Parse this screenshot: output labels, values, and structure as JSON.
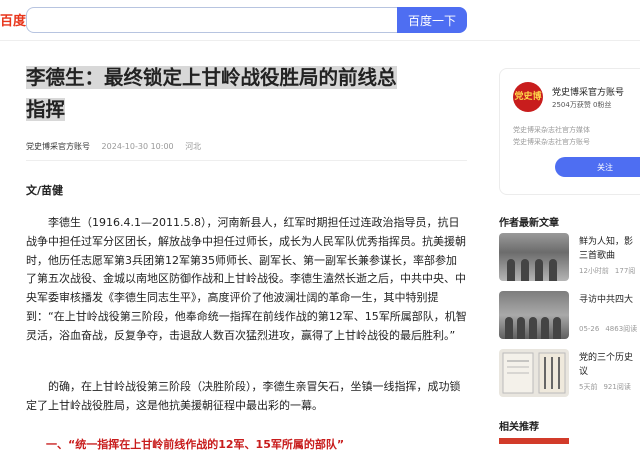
{
  "header": {
    "logo_text": "百度",
    "search_value": "",
    "search_button": "百度一下"
  },
  "article": {
    "title_line1": "李德生：最终锁定上甘岭战役胜局的前线总",
    "title_line2": "指挥",
    "source": "党史博采官方账号",
    "date": "2024-10-30 10:00",
    "location": "河北",
    "byline": "文/苗健",
    "paragraphs": [
      "李德生（1916.4.1—2011.5.8），河南新县人，红军时期担任过连政治指导员，抗日战争中担任过军分区团长，解放战争中担任过师长，成长为人民军队优秀指挥员。抗美援朝时，他历任志愿军第3兵团第12军第35师师长、副军长、第一副军长兼参谋长，率部参加了第五次战役、金城以南地区防御作战和上甘岭战役。李德生溘然长逝之后，中共中央、中央军委审核播发《李德生同志生平》，高度评价了他波澜壮阔的革命一生，其中特别提到：“在上甘岭战役第三阶段，他奉命统一指挥在前线作战的第12军、15军所属部队，机智灵活，浴血奋战，反复争夺，击退敌人数百次猛烈进攻，赢得了上甘岭战役的最后胜利。”",
      "的确，在上甘岭战役第三阶段（决胜阶段），李德生亲冒矢石，坐镇一线指挥，成功锁定了上甘岭战役胜局，这是他抗美援朝征程中最出彩的一幕。"
    ],
    "section_heading": "一、“统一指挥在上甘岭前线作战的12军、15军所属的部队”"
  },
  "sidebar": {
    "avatar_text": "党史博采",
    "account_name": "党史博采官方账号",
    "account_stats": "2504万获赞 0粉丝",
    "account_desc_line1": "党史博采杂志社官方媒体",
    "account_desc_line2": "党史博采杂志社官方账号",
    "follow_button": "关注",
    "latest_heading": "作者最新文章",
    "latest": [
      {
        "title": "鲜为人知，影",
        "subtitle": "三首歌曲",
        "time": "12小时前",
        "reads": "177阅"
      },
      {
        "title": "寻访中共四大",
        "subtitle": "",
        "time": "05-26",
        "reads": "4863阅读"
      },
      {
        "title": "党的三个历史",
        "subtitle": "议",
        "time": "5天前",
        "reads": "921阅读"
      }
    ],
    "related_heading": "相关推荐"
  },
  "colors": {
    "brand_blue": "#4e6ef2",
    "brand_red": "#c81d1d",
    "title_highlight": "#d8d8d8"
  }
}
